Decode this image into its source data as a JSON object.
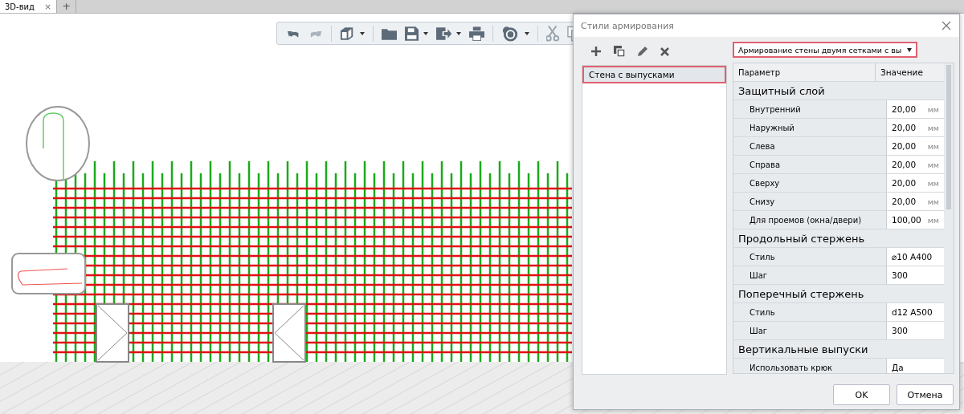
{
  "tabs": [
    {
      "label": "3D-вид",
      "selected": true,
      "close": "×"
    }
  ],
  "add_tab": "+",
  "dialog": {
    "title": "Стили армирования",
    "styles": [
      {
        "label": "Стена с выпусками",
        "selected": true
      }
    ],
    "preset": "Армирование стены двумя сетками с вы",
    "columns": [
      "Параметр",
      "Значение"
    ],
    "groups": [
      {
        "title": "Защитный слой",
        "rows": [
          {
            "label": "Внутренний",
            "value": "20,00",
            "unit": "мм"
          },
          {
            "label": "Наружный",
            "value": "20,00",
            "unit": "мм"
          },
          {
            "label": "Слева",
            "value": "20,00",
            "unit": "мм"
          },
          {
            "label": "Справа",
            "value": "20,00",
            "unit": "мм"
          },
          {
            "label": "Сверху",
            "value": "20,00",
            "unit": "мм"
          },
          {
            "label": "Снизу",
            "value": "20,00",
            "unit": "мм"
          },
          {
            "label": "Для проемов (окна/двери)",
            "value": "100,00",
            "unit": "мм"
          }
        ]
      },
      {
        "title": "Продольный стержень",
        "rows": [
          {
            "label": "Стиль",
            "value": "⌀10 A400"
          },
          {
            "label": "Шаг",
            "value": "300"
          }
        ]
      },
      {
        "title": "Поперечный стержень",
        "rows": [
          {
            "label": "Стиль",
            "value": "d12 A500"
          },
          {
            "label": "Шаг",
            "value": "300"
          }
        ]
      },
      {
        "title": "Вертикальные выпуски",
        "rows": [
          {
            "label": "Использовать крюк",
            "value": "Да"
          }
        ]
      }
    ],
    "buttons": [
      "OK",
      "Отмена"
    ]
  }
}
